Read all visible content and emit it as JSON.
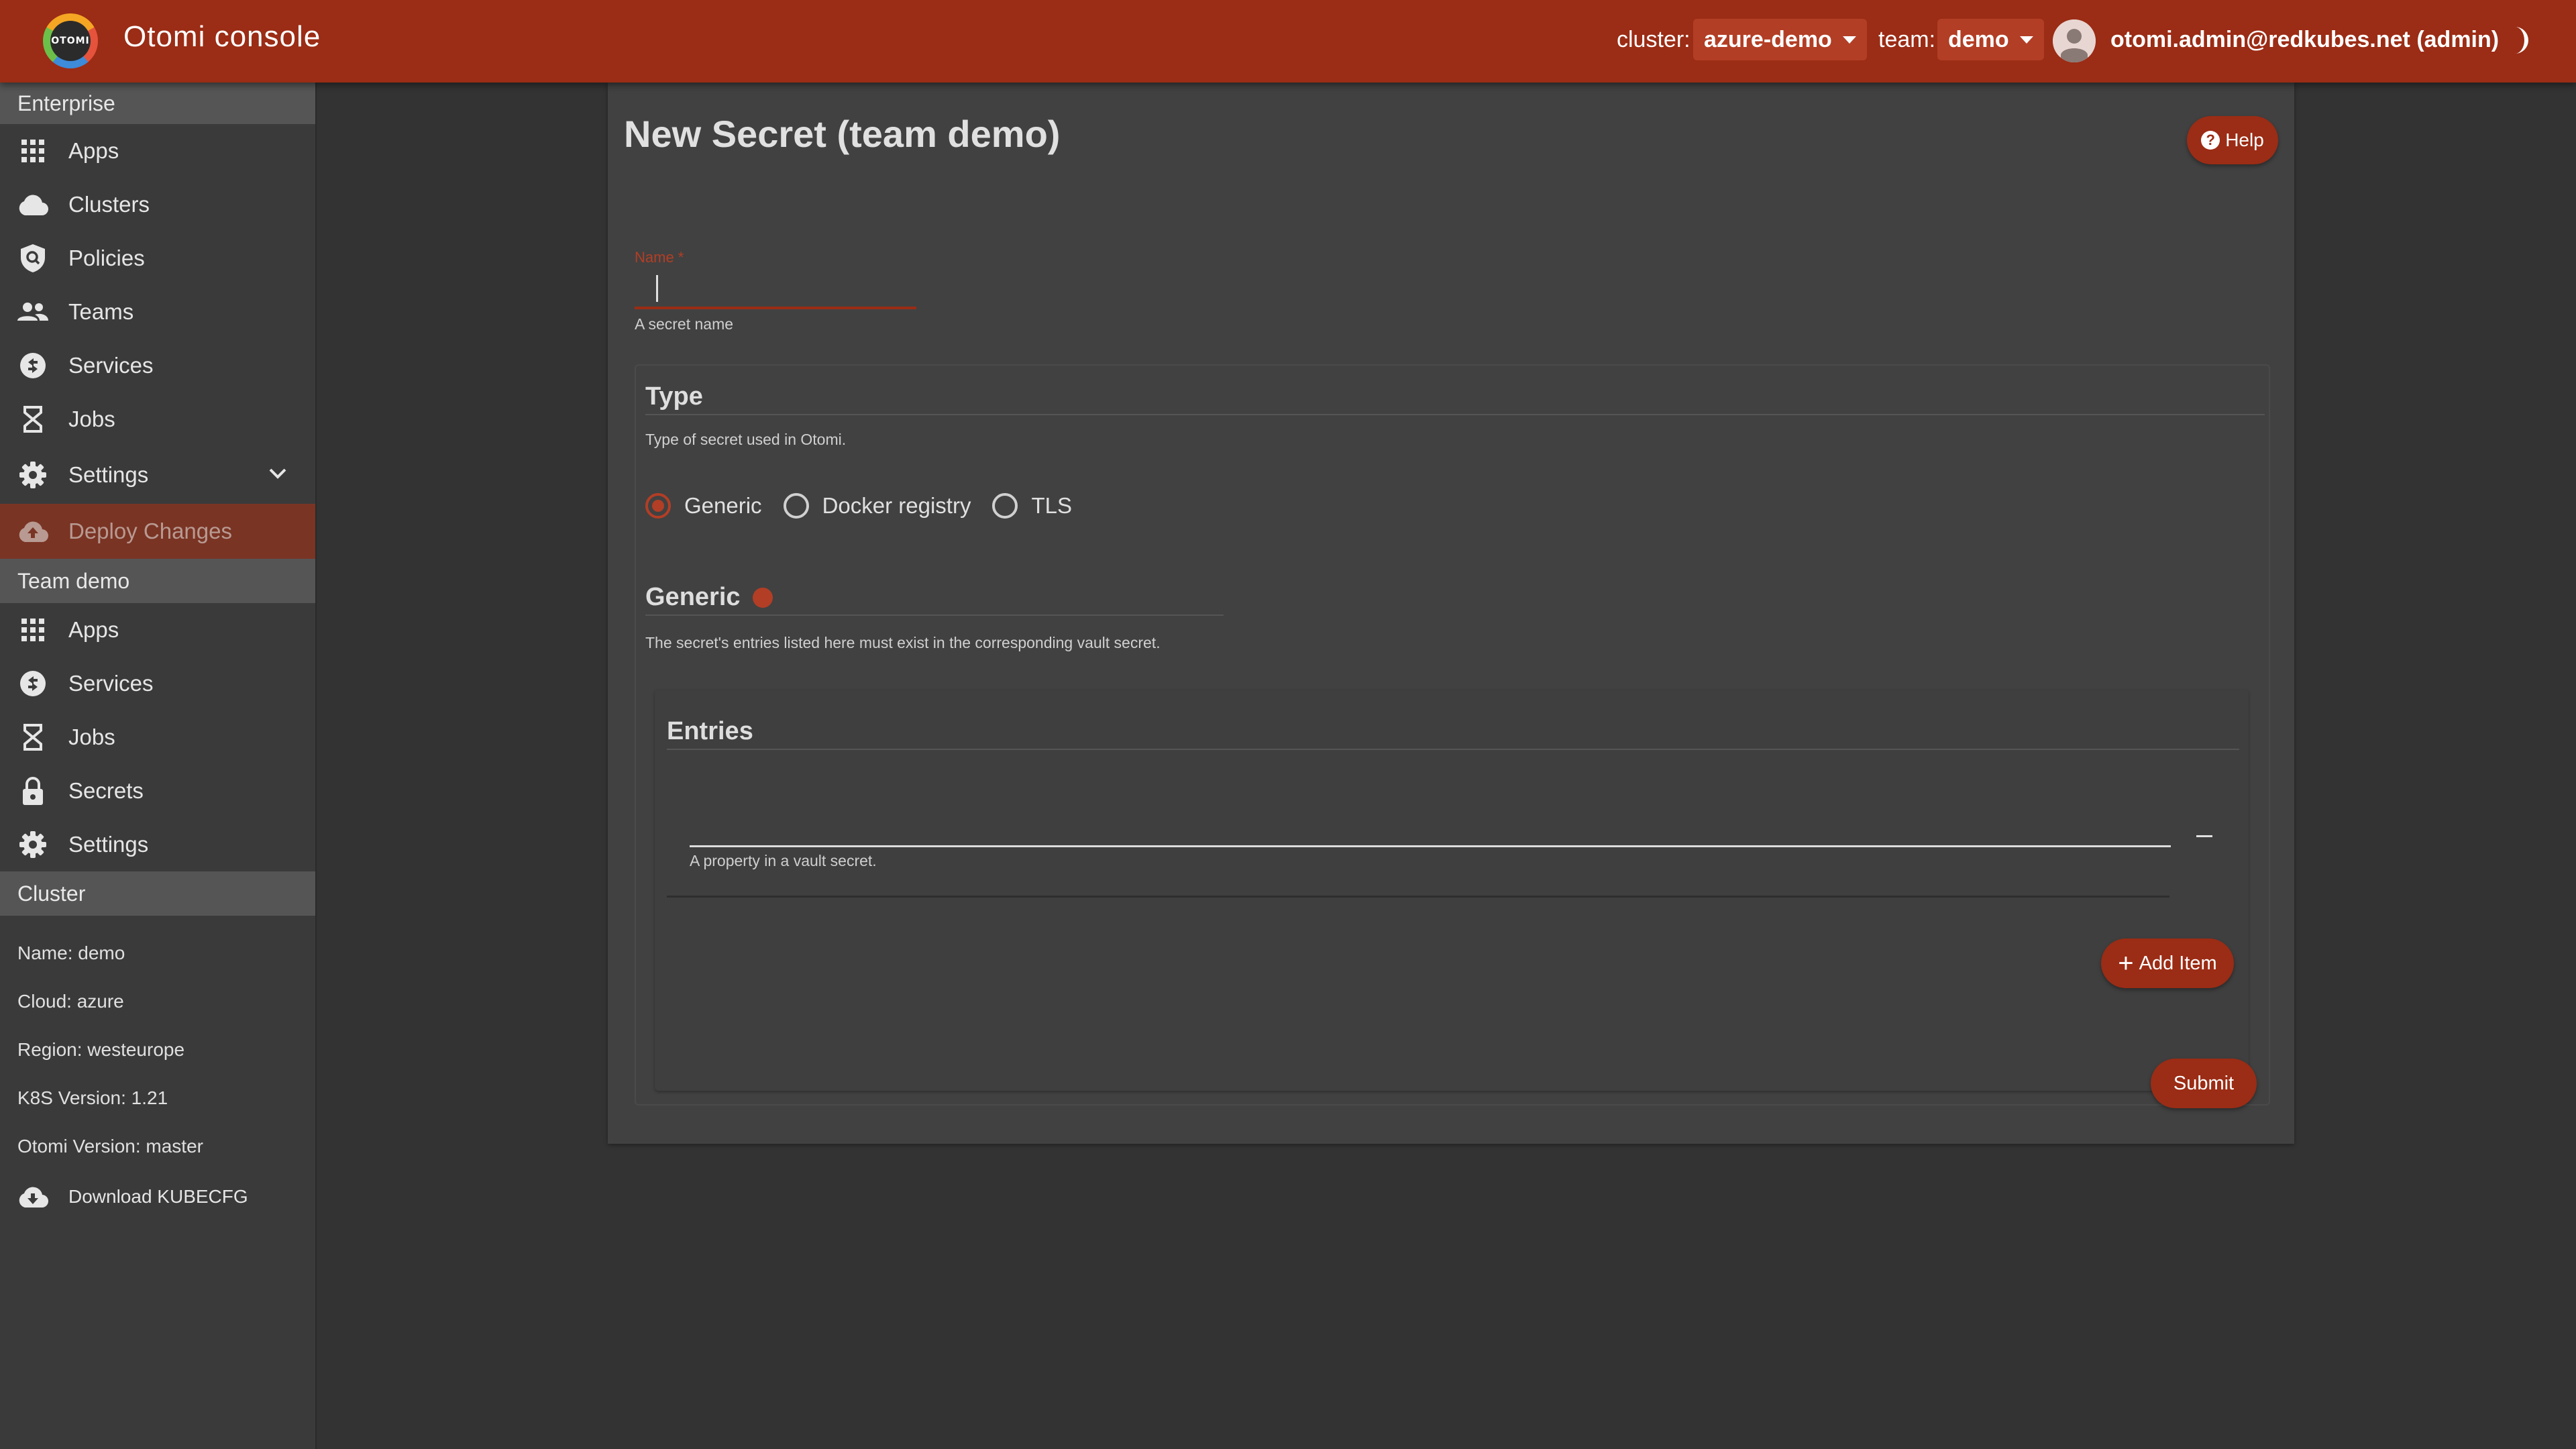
{
  "header": {
    "logo_text": "OTOMI",
    "app_title": "Otomi console",
    "cluster_label": "cluster:",
    "cluster_value": "azure-demo",
    "team_label": "team:",
    "team_value": "demo",
    "user": "otomi.admin@redkubes.net (admin)",
    "bar_color": "#9b2c15"
  },
  "sidebar": {
    "enterprise_title": "Enterprise",
    "enterprise_items": [
      {
        "label": "Apps",
        "icon": "apps-grid-icon"
      },
      {
        "label": "Clusters",
        "icon": "cloud-icon"
      },
      {
        "label": "Policies",
        "icon": "shield-icon"
      },
      {
        "label": "Teams",
        "icon": "people-icon"
      },
      {
        "label": "Services",
        "icon": "services-icon"
      },
      {
        "label": "Jobs",
        "icon": "hourglass-icon"
      },
      {
        "label": "Settings",
        "icon": "gear-icon"
      }
    ],
    "deploy_label": "Deploy Changes",
    "team_title": "Team demo",
    "team_items": [
      {
        "label": "Apps",
        "icon": "apps-grid-icon"
      },
      {
        "label": "Services",
        "icon": "services-icon"
      },
      {
        "label": "Jobs",
        "icon": "hourglass-icon"
      },
      {
        "label": "Secrets",
        "icon": "lock-icon"
      },
      {
        "label": "Settings",
        "icon": "gear-icon"
      }
    ],
    "cluster_title": "Cluster",
    "cluster_info": [
      "Name: demo",
      "Cloud: azure",
      "Region: westeurope",
      "K8S Version: 1.21",
      "Otomi Version: master"
    ],
    "download_label": "Download KUBECFG"
  },
  "form": {
    "page_title": "New Secret (team demo)",
    "help_label": "Help",
    "name_label": "Name *",
    "name_value": "",
    "name_helper": "A secret name",
    "type_title": "Type",
    "type_desc": "Type of secret used in Otomi.",
    "type_options": [
      "Generic",
      "Docker registry",
      "TLS"
    ],
    "type_selected": "Generic",
    "generic_title": "Generic",
    "generic_desc": "The secret's entries listed here must exist in the corresponding vault secret.",
    "entries_title": "Entries",
    "entry_value": "",
    "entry_helper": "A property in a vault secret.",
    "add_item_label": "Add Item",
    "submit_label": "Submit"
  }
}
